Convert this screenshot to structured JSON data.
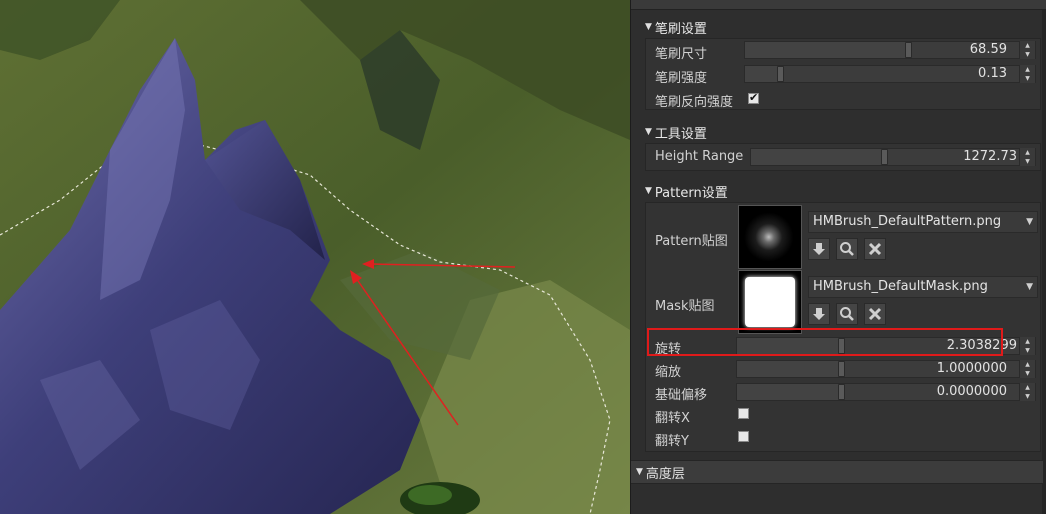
{
  "brush_section": {
    "title": "笔刷设置",
    "brush_size": {
      "label": "笔刷尺寸",
      "value": "68.59",
      "level": 0.6
    },
    "brush_strength": {
      "label": "笔刷强度",
      "value": "0.13",
      "level": 0.13
    },
    "brush_invert": {
      "label": "笔刷反向强度",
      "checked": true
    }
  },
  "tool_section": {
    "title": "工具设置",
    "height_range": {
      "label": "Height Range",
      "value": "1272.73",
      "level": 0.5
    }
  },
  "pattern_section": {
    "title": "Pattern设置",
    "pattern_texture": {
      "label": "Pattern贴图",
      "file": "HMBrush_DefaultPattern.png"
    },
    "mask_texture": {
      "label": "Mask贴图",
      "file": "HMBrush_DefaultMask.png"
    },
    "rotation": {
      "label": "旋转",
      "value": "2.3038299",
      "level": 0.37
    },
    "scale": {
      "label": "缩放",
      "value": "1.0000000",
      "level": 0.37
    },
    "base_offset": {
      "label": "基础偏移",
      "value": "0.0000000",
      "level": 0.37
    },
    "flip_x": {
      "label": "翻转X",
      "checked": false
    },
    "flip_y": {
      "label": "翻转Y",
      "checked": false
    }
  },
  "height_layer": {
    "title": "高度层"
  },
  "colors": {
    "highlight": "#e01a1a",
    "arrow": "#e02020",
    "panel_bg": "#2e2e2e"
  },
  "icons": [
    "collapse-triangle-icon",
    "download-arrow-icon",
    "magnifier-icon",
    "close-x-icon",
    "checkmark-icon",
    "spin-up-icon",
    "spin-down-icon",
    "dropdown-arrow-icon"
  ]
}
